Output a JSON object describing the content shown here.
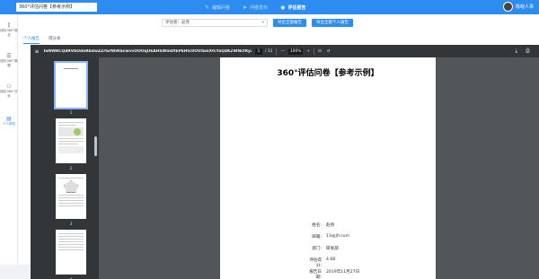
{
  "header": {
    "doc_title": "360°评估问卷【参考示例】",
    "steps": [
      {
        "icon": "edit-icon",
        "label": "编辑问卷",
        "active": false
      },
      {
        "icon": "send-icon",
        "label": "问卷发布",
        "active": false
      },
      {
        "icon": "report-icon",
        "label": "评估报告",
        "active": true
      }
    ],
    "user_name": "陈晓人事"
  },
  "sidebar": {
    "items": [
      {
        "icon": "chart-icon",
        "label": "团队360°报告"
      },
      {
        "icon": "list-icon",
        "label": "团队360°数据"
      },
      {
        "icon": "team-icon",
        "label": "团队360°分析"
      },
      {
        "icon": "person-report-icon",
        "label": "个人报告"
      }
    ]
  },
  "toolbar": {
    "select_value": "评估者：赵燕",
    "export_label": "导出全部报告",
    "export_all_label": "导出全部个人报告"
  },
  "tabs": [
    {
      "label": "个人报告",
      "active": true
    },
    {
      "label": "得分表",
      "active": false
    }
  ],
  "pdf": {
    "filename": "TaNWRCQdRVbOdaRbdwZZrGrNhRSnwvvOOOqUkAHSWmDtEPkHtc0OVISmXfcYaQ4KZWNcfRyZMNCm...",
    "page_current": "1",
    "page_total": "/ 11",
    "zoom": "100%",
    "thumbnail_numbers": [
      "1",
      "2",
      "3",
      "4"
    ],
    "document_title": "360°评估问卷【参考示例】",
    "info_rows": [
      {
        "key": "姓名:",
        "value": "赵燕"
      },
      {
        "key": "邮箱:",
        "value": "13@jfr.com"
      },
      {
        "key": "部门:",
        "value": "研发部"
      },
      {
        "key": "评估得分:",
        "value": "4.68"
      },
      {
        "key": "报告日期:",
        "value": "2019年11月27日"
      }
    ]
  }
}
